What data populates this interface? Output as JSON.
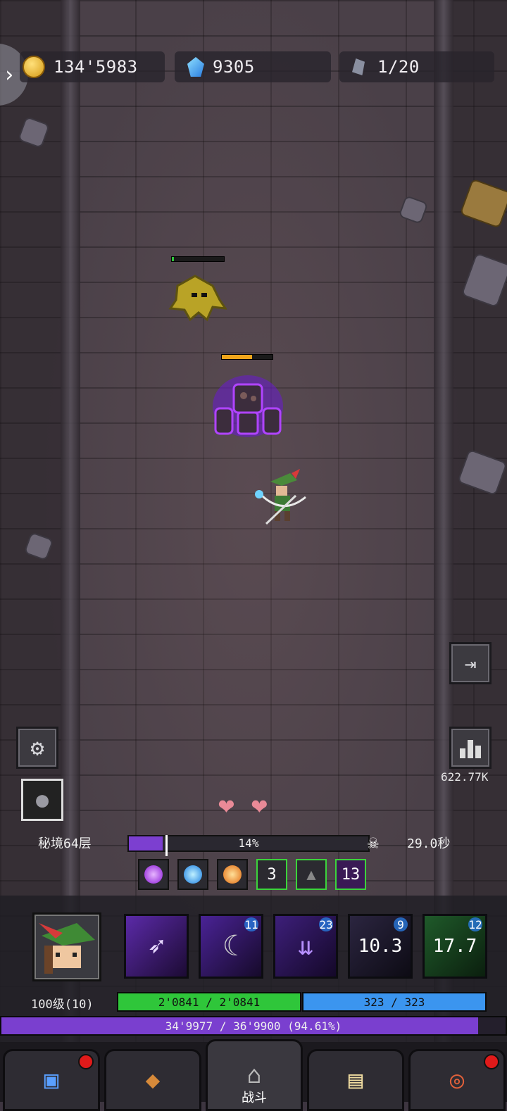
{
  "resources": {
    "gold": "134'5983",
    "gems": "9305",
    "keys": "1/20"
  },
  "side_buttons": {
    "dps_value": "622.77K"
  },
  "stage": {
    "name": "秘境64层",
    "progress_label": "14%",
    "progress": 0.14,
    "timer": "29.0秒"
  },
  "buffs": [
    {
      "icon": "purple-orb-icon",
      "count": ""
    },
    {
      "icon": "blue-orb-icon",
      "count": ""
    },
    {
      "icon": "orange-orb-icon",
      "count": ""
    },
    {
      "icon": "banner-icon",
      "count": "3"
    },
    {
      "icon": "hood-icon",
      "count": ""
    },
    {
      "icon": "dark-blade-icon",
      "count": "13"
    }
  ],
  "skills": [
    {
      "icon": "dark-arrow-icon",
      "level": "",
      "cooldown": ""
    },
    {
      "icon": "scythe-icon",
      "level": "11",
      "cooldown": ""
    },
    {
      "icon": "arrow-rain-icon",
      "level": "23",
      "cooldown": ""
    },
    {
      "icon": "reaper-icon",
      "level": "9",
      "cooldown": "10.3"
    },
    {
      "icon": "beast-claw-icon",
      "level": "12",
      "cooldown": "17.7"
    }
  ],
  "player": {
    "level": "100级(10)",
    "hp": "2'0841 / 2'0841",
    "mp": "323 / 323",
    "xp": "34'9977 / 36'9900 (94.61%)",
    "xp_fraction": 0.9461
  },
  "tabs": [
    {
      "icon": "chest-icon",
      "label": "",
      "badge": true
    },
    {
      "icon": "backpack-icon",
      "label": "",
      "badge": false
    },
    {
      "icon": "dungeon-gate-icon",
      "label": "战斗",
      "badge": false
    },
    {
      "icon": "spellbook-icon",
      "label": "",
      "badge": false
    },
    {
      "icon": "target-icon",
      "label": "",
      "badge": true
    }
  ],
  "colors": {
    "xp": "#7a3fcf",
    "hp": "#2fc63a",
    "mp": "#3b95ef",
    "badge": "#e01a1a"
  }
}
